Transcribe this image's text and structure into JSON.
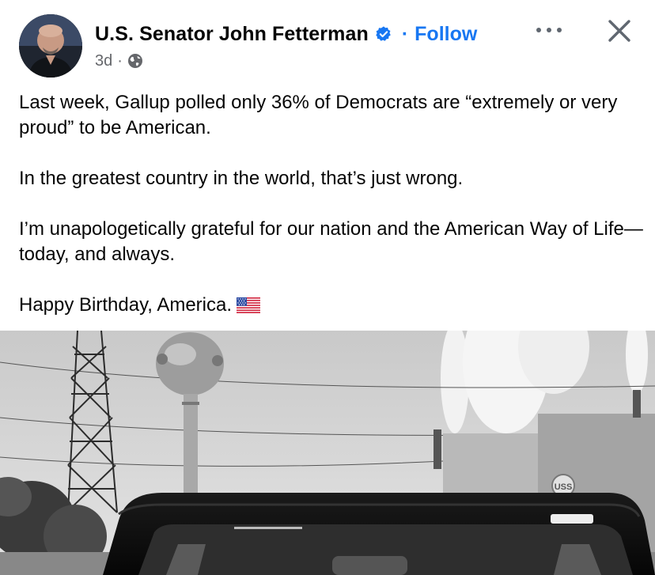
{
  "post": {
    "author": "U.S. Senator John Fetterman",
    "separator": "·",
    "follow_label": "Follow",
    "time": "3d",
    "meta_separator": "·",
    "privacy_icon": "globe-icon",
    "verified_icon": "verified-badge-icon",
    "more_icon": "more-options-icon",
    "close_icon": "close-icon",
    "paragraphs": [
      "Last week, Gallup polled only 36% of Democrats are “extremely or very proud” to be American.",
      "In the greatest country in the world, that’s just wrong.",
      "I’m unapologetically grateful for our nation and the American Way of Life—today, and always.",
      "Happy Birthday, America."
    ],
    "emoji": "us-flag-icon",
    "watermark_text": "USS"
  },
  "colors": {
    "accent": "#1877f2",
    "text": "#050505",
    "secondary": "#65676b"
  }
}
